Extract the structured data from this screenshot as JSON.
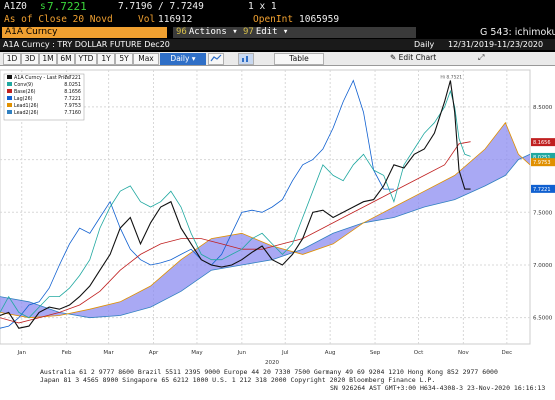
{
  "header": {
    "ticker": "A1Z0",
    "price_prefix": "s",
    "last_price": "7.7221",
    "bid_ask": "7.7196 / 7.7249",
    "size": "1 x 1",
    "as_of": "As of Close 20 Novd",
    "vol_label": "Vol",
    "vol": "116912",
    "oi_label": "OpenInt",
    "oi": "1065959"
  },
  "toolbar": {
    "security": "A1A Curncy",
    "actions_num": "96",
    "actions_label": "Actions ▾",
    "edit_num": "97",
    "edit_label": "Edit ▾",
    "function": "G 543: ichimoku"
  },
  "subheader": {
    "title": "A1A Curncy : TRY DOLLAR FUTURE Dec20",
    "freq": "Daily",
    "range": "12/31/2019-11/23/2020"
  },
  "ranges": [
    "1D",
    "3D",
    "1M",
    "6M",
    "YTD",
    "1Y",
    "5Y",
    "Max"
  ],
  "controls": {
    "period": "Daily ▾",
    "table": "Table",
    "edit_chart": "Edit Chart"
  },
  "footer": {
    "line1": "Australia 61 2 9777 8600 Brazil 5511 2395 9000 Europe 44 20 7330 7500 Germany 49 69 9204 1210 Hong Kong 852 2977 6000",
    "line2": "Japan 81 3 4565 8900          Singapore 65 6212 1000       U.S. 1 212 318 2000        Copyright 2020 Bloomberg Finance L.P.",
    "line3": "SN 926264 AST  GMT+3:00 H634-4308-3 23-Nov-2020 16:16:13"
  },
  "chart_data": {
    "type": "line",
    "xlim": [
      "2019-12-31",
      "2020-12-31"
    ],
    "ylim": [
      6.25,
      8.85
    ],
    "y_ticks": [
      6.5,
      7.0,
      7.5,
      8.0,
      8.5
    ],
    "y_tick_labels": [
      "6.5000",
      "7.0000",
      "7.5000",
      "8.0000",
      "8.5000"
    ],
    "x_ticks": [
      {
        "date": "2020-01-15",
        "label": "Jan"
      },
      {
        "date": "2020-02-15",
        "label": "Feb"
      },
      {
        "date": "2020-03-15",
        "label": "Mar"
      },
      {
        "date": "2020-04-15",
        "label": "Apr"
      },
      {
        "date": "2020-05-15",
        "label": "May"
      },
      {
        "date": "2020-06-15",
        "label": "Jun"
      },
      {
        "date": "2020-07-15",
        "label": "Jul"
      },
      {
        "date": "2020-08-15",
        "label": "Aug"
      },
      {
        "date": "2020-09-15",
        "label": "Sep"
      },
      {
        "date": "2020-10-15",
        "label": "Oct"
      },
      {
        "date": "2020-11-15",
        "label": "Nov"
      },
      {
        "date": "2020-12-15",
        "label": "Dec"
      }
    ],
    "year_label": "2020",
    "grid": true,
    "legend_position": "top-left",
    "legend": [
      {
        "name": "A1A Curncy - Last Price",
        "value": "7.7221",
        "color": "#111111"
      },
      {
        "name": "Conv(9)",
        "value": "8.0251",
        "color": "#20a8a0"
      },
      {
        "name": "Base(26)",
        "value": "8.1656",
        "color": "#c02020"
      },
      {
        "name": "Lag(26)",
        "value": "7.7221",
        "color": "#1060d0"
      },
      {
        "name": "Lead1(26)",
        "value": "7.9753",
        "color": "#e09000"
      },
      {
        "name": "Lead2(26)",
        "value": "7.7160",
        "color": "#3080c0"
      }
    ],
    "right_labels": [
      {
        "value": "8.1656",
        "text": "8.1656",
        "color": "#c02020"
      },
      {
        "value": "8.0251",
        "text": "8.0251",
        "color": "#20a8a0"
      },
      {
        "value": "7.9753",
        "text": "7.9753",
        "color": "#e09000"
      },
      {
        "value": "7.7221",
        "text": "7.7221",
        "color": "#1060d0"
      }
    ],
    "peak_label": {
      "date": "2020-11-06",
      "value": 8.7521,
      "text": "Hi 8.7521"
    },
    "series": [
      {
        "name": "Price",
        "color": "#111111",
        "points": [
          [
            "2019-12-31",
            6.52
          ],
          [
            "2020-01-06",
            6.55
          ],
          [
            "2020-01-13",
            6.4
          ],
          [
            "2020-01-20",
            6.42
          ],
          [
            "2020-01-27",
            6.55
          ],
          [
            "2020-02-03",
            6.6
          ],
          [
            "2020-02-10",
            6.58
          ],
          [
            "2020-02-17",
            6.62
          ],
          [
            "2020-02-24",
            6.7
          ],
          [
            "2020-03-02",
            6.8
          ],
          [
            "2020-03-09",
            6.95
          ],
          [
            "2020-03-16",
            7.1
          ],
          [
            "2020-03-23",
            7.35
          ],
          [
            "2020-03-30",
            7.45
          ],
          [
            "2020-04-06",
            7.2
          ],
          [
            "2020-04-13",
            7.4
          ],
          [
            "2020-04-20",
            7.55
          ],
          [
            "2020-04-27",
            7.6
          ],
          [
            "2020-05-04",
            7.35
          ],
          [
            "2020-05-11",
            7.2
          ],
          [
            "2020-05-18",
            7.05
          ],
          [
            "2020-05-25",
            7.0
          ],
          [
            "2020-06-01",
            6.98
          ],
          [
            "2020-06-08",
            7.0
          ],
          [
            "2020-06-15",
            7.05
          ],
          [
            "2020-06-22",
            7.12
          ],
          [
            "2020-06-29",
            7.18
          ],
          [
            "2020-07-06",
            7.05
          ],
          [
            "2020-07-13",
            7.0
          ],
          [
            "2020-07-20",
            7.1
          ],
          [
            "2020-07-27",
            7.25
          ],
          [
            "2020-08-03",
            7.5
          ],
          [
            "2020-08-10",
            7.52
          ],
          [
            "2020-08-17",
            7.45
          ],
          [
            "2020-08-24",
            7.5
          ],
          [
            "2020-08-31",
            7.55
          ],
          [
            "2020-09-07",
            7.6
          ],
          [
            "2020-09-14",
            7.62
          ],
          [
            "2020-09-21",
            7.75
          ],
          [
            "2020-09-28",
            7.95
          ],
          [
            "2020-10-05",
            7.92
          ],
          [
            "2020-10-12",
            8.05
          ],
          [
            "2020-10-19",
            8.1
          ],
          [
            "2020-10-26",
            8.25
          ],
          [
            "2020-11-02",
            8.55
          ],
          [
            "2020-11-06",
            8.75
          ],
          [
            "2020-11-09",
            8.45
          ],
          [
            "2020-11-12",
            7.9
          ],
          [
            "2020-11-16",
            7.72
          ],
          [
            "2020-11-20",
            7.72
          ]
        ]
      },
      {
        "name": "Conv(9)",
        "color": "#20a8a0",
        "points": [
          [
            "2019-12-31",
            6.55
          ],
          [
            "2020-01-06",
            6.7
          ],
          [
            "2020-01-13",
            6.55
          ],
          [
            "2020-01-20",
            6.5
          ],
          [
            "2020-01-27",
            6.6
          ],
          [
            "2020-02-03",
            6.7
          ],
          [
            "2020-02-10",
            6.7
          ],
          [
            "2020-02-17",
            6.78
          ],
          [
            "2020-02-24",
            6.9
          ],
          [
            "2020-03-02",
            7.05
          ],
          [
            "2020-03-09",
            7.35
          ],
          [
            "2020-03-16",
            7.55
          ],
          [
            "2020-03-23",
            7.7
          ],
          [
            "2020-03-30",
            7.75
          ],
          [
            "2020-04-06",
            7.6
          ],
          [
            "2020-04-13",
            7.55
          ],
          [
            "2020-04-20",
            7.6
          ],
          [
            "2020-04-27",
            7.7
          ],
          [
            "2020-05-04",
            7.55
          ],
          [
            "2020-05-11",
            7.3
          ],
          [
            "2020-05-18",
            7.1
          ],
          [
            "2020-05-25",
            7.05
          ],
          [
            "2020-06-01",
            7.05
          ],
          [
            "2020-06-08",
            7.1
          ],
          [
            "2020-06-15",
            7.15
          ],
          [
            "2020-06-22",
            7.25
          ],
          [
            "2020-06-29",
            7.3
          ],
          [
            "2020-07-06",
            7.2
          ],
          [
            "2020-07-13",
            7.1
          ],
          [
            "2020-07-20",
            7.2
          ],
          [
            "2020-07-27",
            7.45
          ],
          [
            "2020-08-03",
            7.7
          ],
          [
            "2020-08-10",
            7.95
          ],
          [
            "2020-08-17",
            7.85
          ],
          [
            "2020-08-24",
            7.8
          ],
          [
            "2020-08-31",
            7.95
          ],
          [
            "2020-09-07",
            8.05
          ],
          [
            "2020-09-14",
            7.9
          ],
          [
            "2020-09-21",
            7.85
          ],
          [
            "2020-09-28",
            7.6
          ],
          [
            "2020-10-05",
            7.95
          ],
          [
            "2020-10-12",
            8.1
          ],
          [
            "2020-10-19",
            8.25
          ],
          [
            "2020-10-26",
            8.35
          ],
          [
            "2020-11-02",
            8.5
          ],
          [
            "2020-11-06",
            8.65
          ],
          [
            "2020-11-09",
            8.5
          ],
          [
            "2020-11-12",
            8.2
          ],
          [
            "2020-11-16",
            8.05
          ],
          [
            "2020-11-20",
            8.03
          ]
        ]
      },
      {
        "name": "Base(26)",
        "color": "#c02020",
        "points": [
          [
            "2019-12-31",
            6.5
          ],
          [
            "2020-01-13",
            6.45
          ],
          [
            "2020-01-27",
            6.5
          ],
          [
            "2020-02-10",
            6.55
          ],
          [
            "2020-02-24",
            6.62
          ],
          [
            "2020-03-09",
            6.75
          ],
          [
            "2020-03-23",
            6.95
          ],
          [
            "2020-04-06",
            7.1
          ],
          [
            "2020-04-20",
            7.2
          ],
          [
            "2020-05-04",
            7.25
          ],
          [
            "2020-05-18",
            7.25
          ],
          [
            "2020-06-01",
            7.2
          ],
          [
            "2020-06-15",
            7.15
          ],
          [
            "2020-06-29",
            7.15
          ],
          [
            "2020-07-13",
            7.2
          ],
          [
            "2020-07-27",
            7.25
          ],
          [
            "2020-08-10",
            7.35
          ],
          [
            "2020-08-24",
            7.45
          ],
          [
            "2020-09-07",
            7.55
          ],
          [
            "2020-09-21",
            7.65
          ],
          [
            "2020-10-05",
            7.75
          ],
          [
            "2020-10-19",
            7.85
          ],
          [
            "2020-11-02",
            7.95
          ],
          [
            "2020-11-12",
            8.15
          ],
          [
            "2020-11-20",
            8.17
          ]
        ]
      },
      {
        "name": "Lag(26)",
        "color": "#1060d0",
        "points": [
          [
            "2019-12-31",
            6.4
          ],
          [
            "2020-01-06",
            6.42
          ],
          [
            "2020-01-13",
            6.5
          ],
          [
            "2020-01-20",
            6.62
          ],
          [
            "2020-01-27",
            6.65
          ],
          [
            "2020-02-03",
            6.78
          ],
          [
            "2020-02-10",
            7.0
          ],
          [
            "2020-02-17",
            7.2
          ],
          [
            "2020-02-24",
            7.35
          ],
          [
            "2020-03-02",
            7.3
          ],
          [
            "2020-03-09",
            7.45
          ],
          [
            "2020-03-16",
            7.6
          ],
          [
            "2020-03-23",
            7.35
          ],
          [
            "2020-03-30",
            7.15
          ],
          [
            "2020-04-06",
            7.05
          ],
          [
            "2020-04-13",
            7.0
          ],
          [
            "2020-04-20",
            7.02
          ],
          [
            "2020-04-27",
            7.05
          ],
          [
            "2020-05-04",
            7.1
          ],
          [
            "2020-05-11",
            7.15
          ],
          [
            "2020-05-18",
            7.05
          ],
          [
            "2020-05-25",
            7.0
          ],
          [
            "2020-06-01",
            7.1
          ],
          [
            "2020-06-08",
            7.3
          ],
          [
            "2020-06-15",
            7.5
          ],
          [
            "2020-06-22",
            7.52
          ],
          [
            "2020-06-29",
            7.5
          ],
          [
            "2020-07-06",
            7.55
          ],
          [
            "2020-07-13",
            7.62
          ],
          [
            "2020-07-20",
            7.8
          ],
          [
            "2020-07-27",
            7.95
          ],
          [
            "2020-08-03",
            8.0
          ],
          [
            "2020-08-10",
            8.1
          ],
          [
            "2020-08-17",
            8.3
          ],
          [
            "2020-08-24",
            8.55
          ],
          [
            "2020-08-31",
            8.75
          ],
          [
            "2020-09-07",
            8.45
          ],
          [
            "2020-09-14",
            7.9
          ],
          [
            "2020-09-21",
            7.72
          ],
          [
            "2020-09-28",
            7.72
          ]
        ]
      },
      {
        "name": "Lead1(26)",
        "color": "#e09000",
        "points": [
          [
            "2019-12-31",
            6.55
          ],
          [
            "2020-01-20",
            6.5
          ],
          [
            "2020-02-10",
            6.52
          ],
          [
            "2020-03-02",
            6.58
          ],
          [
            "2020-03-23",
            6.65
          ],
          [
            "2020-04-13",
            6.8
          ],
          [
            "2020-05-04",
            7.05
          ],
          [
            "2020-05-25",
            7.25
          ],
          [
            "2020-06-15",
            7.3
          ],
          [
            "2020-07-06",
            7.18
          ],
          [
            "2020-07-27",
            7.1
          ],
          [
            "2020-08-17",
            7.2
          ],
          [
            "2020-09-07",
            7.4
          ],
          [
            "2020-09-28",
            7.55
          ],
          [
            "2020-10-19",
            7.7
          ],
          [
            "2020-11-09",
            7.85
          ],
          [
            "2020-11-30",
            8.1
          ],
          [
            "2020-12-14",
            8.35
          ],
          [
            "2020-12-23",
            8.05
          ],
          [
            "2020-12-31",
            7.95
          ]
        ]
      },
      {
        "name": "Lead2(26)",
        "color": "#3080c0",
        "points": [
          [
            "2019-12-31",
            6.7
          ],
          [
            "2020-01-20",
            6.65
          ],
          [
            "2020-02-10",
            6.55
          ],
          [
            "2020-03-02",
            6.5
          ],
          [
            "2020-03-23",
            6.52
          ],
          [
            "2020-04-13",
            6.6
          ],
          [
            "2020-05-04",
            6.75
          ],
          [
            "2020-05-25",
            6.95
          ],
          [
            "2020-06-15",
            7.0
          ],
          [
            "2020-07-06",
            7.05
          ],
          [
            "2020-07-27",
            7.15
          ],
          [
            "2020-08-17",
            7.3
          ],
          [
            "2020-09-07",
            7.4
          ],
          [
            "2020-09-28",
            7.45
          ],
          [
            "2020-10-19",
            7.55
          ],
          [
            "2020-11-09",
            7.62
          ],
          [
            "2020-11-30",
            7.75
          ],
          [
            "2020-12-14",
            7.85
          ],
          [
            "2020-12-23",
            8.0
          ],
          [
            "2020-12-31",
            8.05
          ]
        ]
      }
    ]
  }
}
